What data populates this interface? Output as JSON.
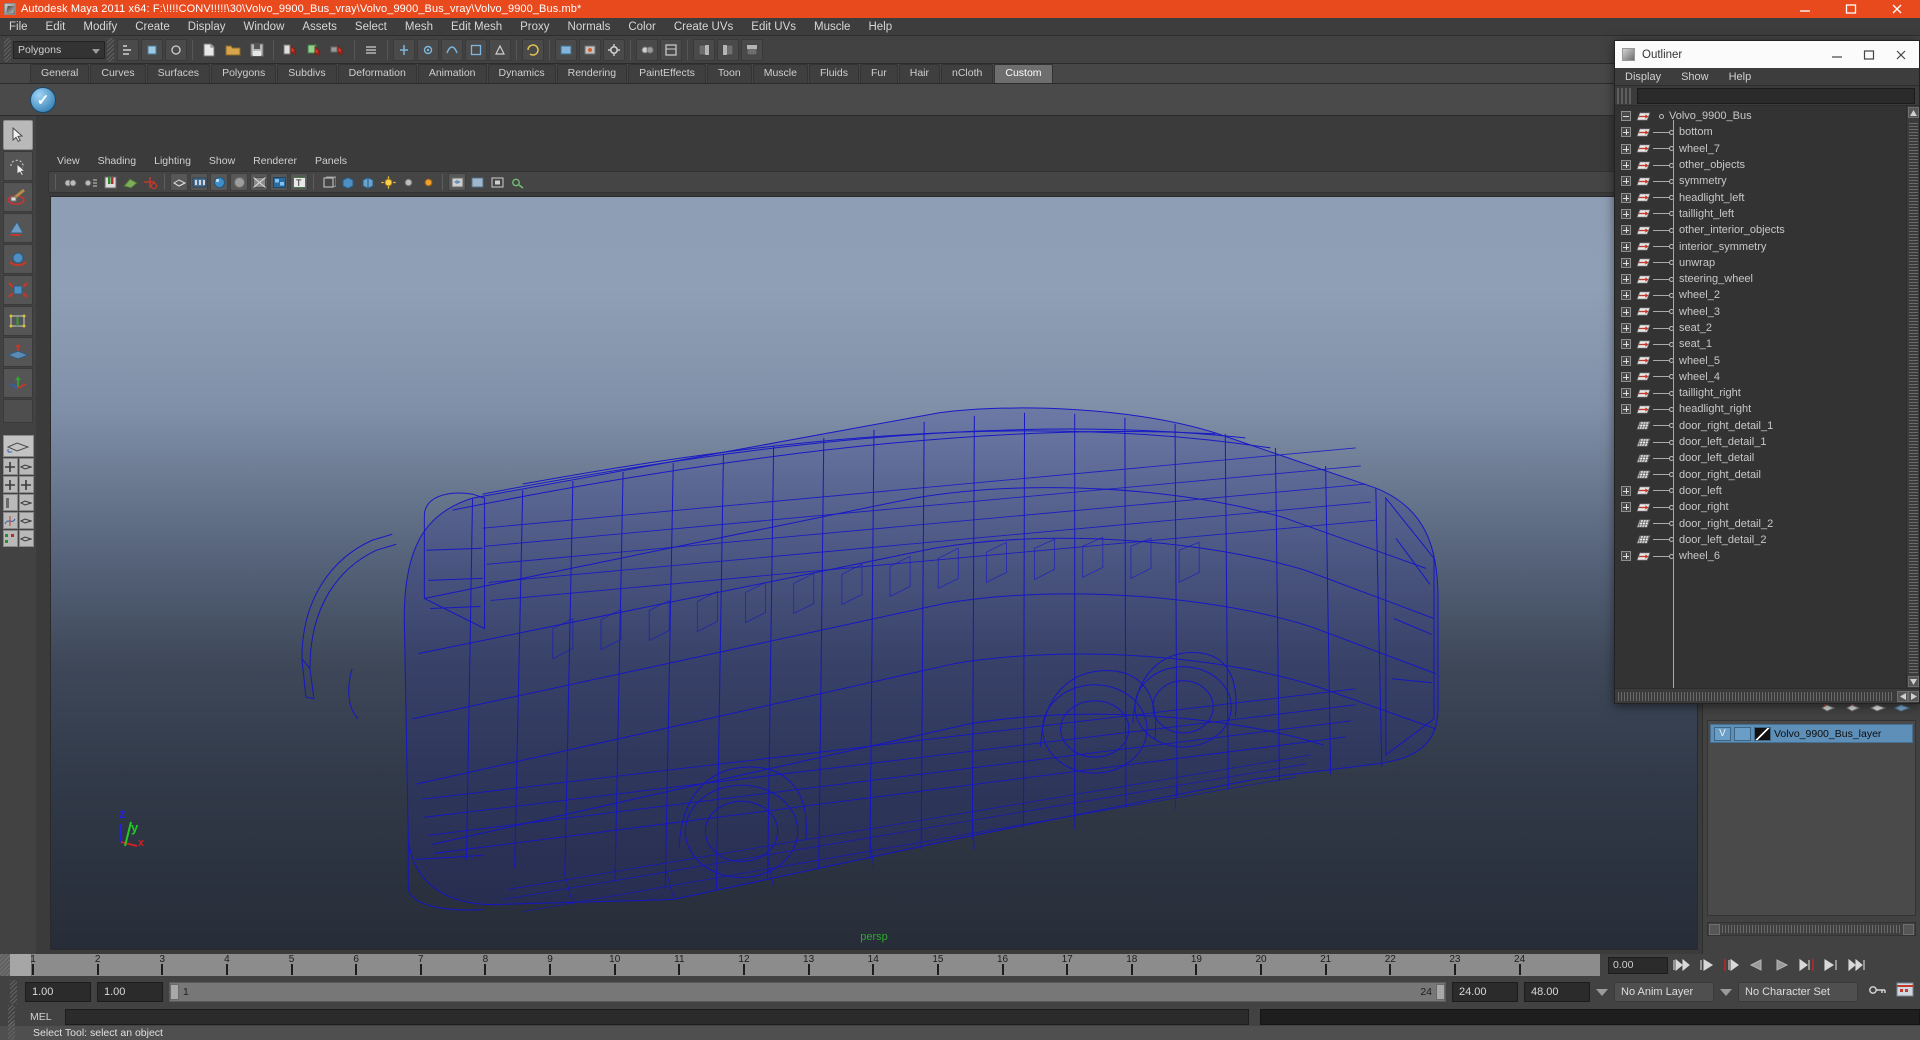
{
  "window": {
    "title": "Autodesk Maya 2011 x64: F:\\!!!!CONV!!!!!\\30\\Volvo_9900_Bus_vray\\Volvo_9900_Bus_vray\\Volvo_9900_Bus.mb*",
    "minimize_label": "minimize-icon",
    "maximize_label": "maximize-icon",
    "close_label": "close-icon",
    "accent_color": "#e8491d"
  },
  "menubar": {
    "items": [
      "File",
      "Edit",
      "Modify",
      "Create",
      "Display",
      "Window",
      "Assets",
      "Select",
      "Mesh",
      "Edit Mesh",
      "Proxy",
      "Normals",
      "Color",
      "Create UVs",
      "Edit UVs",
      "Muscle",
      "Help"
    ]
  },
  "statusbar": {
    "mode_selector": "Polygons"
  },
  "shelf": {
    "tabs": [
      "General",
      "Curves",
      "Surfaces",
      "Polygons",
      "Subdivs",
      "Deformation",
      "Animation",
      "Dynamics",
      "Rendering",
      "PaintEffects",
      "Toon",
      "Muscle",
      "Fluids",
      "Fur",
      "Hair",
      "nCloth",
      "Custom"
    ],
    "active_tab": "Custom",
    "active_icon": "checkmark-sphere-icon"
  },
  "toolbox": {
    "tools": [
      "select-tool",
      "lasso-select-tool",
      "paint-select-tool",
      "move-tool",
      "rotate-tool",
      "scale-tool",
      "universal-manipulator-tool",
      "soft-modification-tool",
      "last-tool-used",
      "blank-tool"
    ],
    "layout_presets": [
      "single-perspective-view",
      "four-view",
      "two-pane-side",
      "outliner-persp",
      "graph-editor-persp",
      "hypershade-persp"
    ]
  },
  "viewport": {
    "panel_menus": [
      "View",
      "Shading",
      "Lighting",
      "Show",
      "Renderer",
      "Panels"
    ],
    "camera_label": "persp",
    "axis": {
      "x": "x",
      "y": "y",
      "z": "z"
    },
    "model_name": "Volvo_9900_Bus",
    "wireframe_color": "#1515c8",
    "background_top": "#8e9eb4",
    "background_bottom": "#272d38"
  },
  "outliner": {
    "title": "Outliner",
    "menus": [
      "Display",
      "Show",
      "Help"
    ],
    "search_value": "",
    "tree": [
      {
        "name": "Volvo_9900_Bus",
        "depth": 0,
        "expand": "minus",
        "icon": "transform-icon"
      },
      {
        "name": "bottom",
        "depth": 1,
        "expand": "plus",
        "icon": "transform-icon"
      },
      {
        "name": "wheel_7",
        "depth": 1,
        "expand": "plus",
        "icon": "transform-icon"
      },
      {
        "name": "other_objects",
        "depth": 1,
        "expand": "plus",
        "icon": "transform-icon"
      },
      {
        "name": "symmetry",
        "depth": 1,
        "expand": "plus",
        "icon": "transform-icon"
      },
      {
        "name": "headlight_left",
        "depth": 1,
        "expand": "plus",
        "icon": "transform-icon"
      },
      {
        "name": "taillight_left",
        "depth": 1,
        "expand": "plus",
        "icon": "transform-icon"
      },
      {
        "name": "other_interior_objects",
        "depth": 1,
        "expand": "plus",
        "icon": "transform-icon"
      },
      {
        "name": "interior_symmetry",
        "depth": 1,
        "expand": "plus",
        "icon": "transform-icon"
      },
      {
        "name": "unwrap",
        "depth": 1,
        "expand": "plus",
        "icon": "transform-icon"
      },
      {
        "name": "steering_wheel",
        "depth": 1,
        "expand": "plus",
        "icon": "transform-icon"
      },
      {
        "name": "wheel_2",
        "depth": 1,
        "expand": "plus",
        "icon": "transform-icon"
      },
      {
        "name": "wheel_3",
        "depth": 1,
        "expand": "plus",
        "icon": "transform-icon"
      },
      {
        "name": "seat_2",
        "depth": 1,
        "expand": "plus",
        "icon": "transform-icon"
      },
      {
        "name": "seat_1",
        "depth": 1,
        "expand": "plus",
        "icon": "transform-icon"
      },
      {
        "name": "wheel_5",
        "depth": 1,
        "expand": "plus",
        "icon": "transform-icon"
      },
      {
        "name": "wheel_4",
        "depth": 1,
        "expand": "plus",
        "icon": "transform-icon"
      },
      {
        "name": "taillight_right",
        "depth": 1,
        "expand": "plus",
        "icon": "transform-icon"
      },
      {
        "name": "headlight_right",
        "depth": 1,
        "expand": "plus",
        "icon": "transform-icon"
      },
      {
        "name": "door_right_detail_1",
        "depth": 1,
        "expand": "none",
        "icon": "mesh-icon"
      },
      {
        "name": "door_left_detail_1",
        "depth": 1,
        "expand": "none",
        "icon": "mesh-icon"
      },
      {
        "name": "door_left_detail",
        "depth": 1,
        "expand": "none",
        "icon": "mesh-icon"
      },
      {
        "name": "door_right_detail",
        "depth": 1,
        "expand": "none",
        "icon": "mesh-icon"
      },
      {
        "name": "door_left",
        "depth": 1,
        "expand": "plus",
        "icon": "transform-icon"
      },
      {
        "name": "door_right",
        "depth": 1,
        "expand": "plus",
        "icon": "transform-icon"
      },
      {
        "name": "door_right_detail_2",
        "depth": 1,
        "expand": "none",
        "icon": "mesh-icon"
      },
      {
        "name": "door_left_detail_2",
        "depth": 1,
        "expand": "none",
        "icon": "mesh-icon"
      },
      {
        "name": "wheel_6",
        "depth": 1,
        "expand": "plus",
        "icon": "transform-icon"
      }
    ]
  },
  "layer_editor": {
    "layers": [
      {
        "visibility": "V",
        "playback": "",
        "swatch": "diagonal-black-white",
        "name": "Volvo_9900_Bus_layer",
        "selected": true
      }
    ]
  },
  "time_slider": {
    "ticks": [
      1,
      2,
      3,
      4,
      5,
      6,
      7,
      8,
      9,
      10,
      11,
      12,
      13,
      14,
      15,
      16,
      17,
      18,
      19,
      20,
      21,
      22,
      23,
      24
    ],
    "current_time": "0.00",
    "playback_buttons": [
      "go-to-start-icon",
      "step-back-frame-icon",
      "step-back-key-icon",
      "play-backwards-icon",
      "play-forwards-icon",
      "step-forward-key-icon",
      "step-forward-frame-icon",
      "go-to-end-icon"
    ]
  },
  "range_slider": {
    "anim_start": "1.00",
    "range_start": "1.00",
    "range_bar_start": "1",
    "range_bar_end": "24",
    "range_end": "24.00",
    "anim_end": "48.00",
    "anim_layer": "No Anim Layer",
    "character_set": "No Character Set",
    "key_icon": "key-icon",
    "auto_key_icon": "auto-keyframe-icon"
  },
  "command_line": {
    "label": "MEL",
    "value": ""
  },
  "status_line": {
    "message": "Select Tool: select an object"
  }
}
